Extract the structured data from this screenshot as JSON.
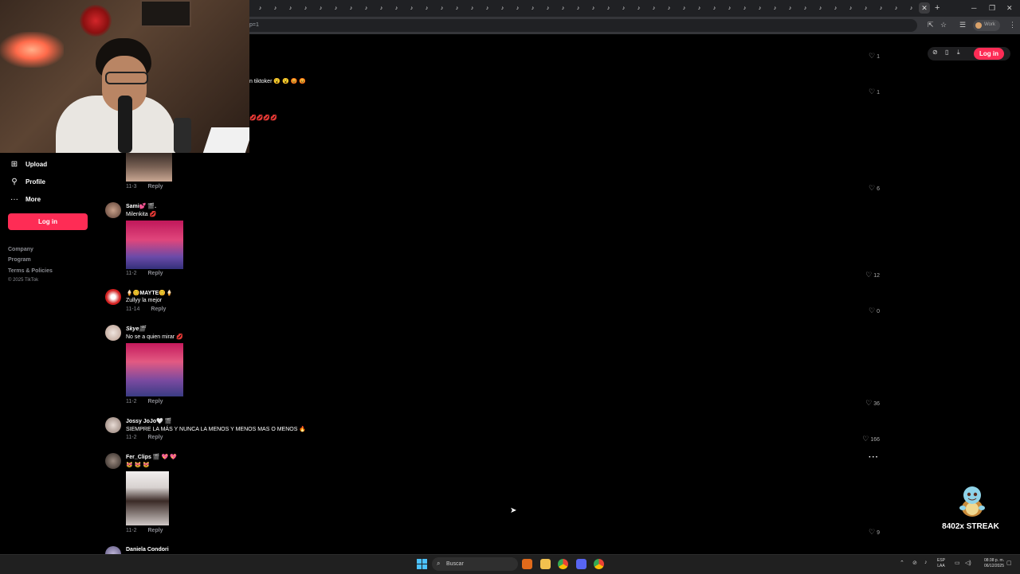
{
  "browser": {
    "tab_icon": "tiktok-icon",
    "tab_count": 44,
    "url_fragment": "p=1",
    "profile_label": "Work"
  },
  "sidebar": {
    "items": [
      {
        "label": "Upload",
        "icon": "plus-square-icon"
      },
      {
        "label": "Profile",
        "icon": "person-icon"
      },
      {
        "label": "More",
        "icon": "dots-icon"
      }
    ],
    "login_label": "Log in",
    "footer": [
      "Company",
      "Program",
      "Terms & Policies"
    ],
    "copyright": "© 2025 TikTok"
  },
  "header": {
    "login_label": "Log in"
  },
  "partial_lines": [
    {
      "text": "n tiktoker 😮 😮 😡 😡"
    },
    {
      "text": "💋💋💋💋"
    }
  ],
  "comments": [
    {
      "user": "",
      "text": "",
      "date": "11-3",
      "reply": "Reply",
      "likes": "1"
    },
    {
      "user": "",
      "text": "",
      "date": "",
      "reply": "",
      "likes": "1"
    },
    {
      "user": "",
      "text": "",
      "date": "11-3",
      "reply": "Reply",
      "likes": "6"
    },
    {
      "user": "Sami💕 🎬.",
      "text": "Milenkita 💋",
      "date": "11-2",
      "reply": "Reply",
      "likes": "12"
    },
    {
      "user": "🍦😊MAYTE😊🍦",
      "text": "Zullyy la mejor",
      "date": "11-14",
      "reply": "Reply",
      "likes": "0"
    },
    {
      "user": "Skye🎬",
      "text": "No se a quien mirar 💋",
      "date": "11-2",
      "reply": "Reply",
      "likes": "36"
    },
    {
      "user": "Jossy JoJo🤍 🎬",
      "text": "SIEMPRE LA MÁS Y NUNCA LA MENOS Y MENOS MAS O MENOS 🔥",
      "date": "11-2",
      "reply": "Reply",
      "likes": "166"
    },
    {
      "user": "Fer_Clips 🎬 💖 💖",
      "text": "😻 😻 😻",
      "date": "11-2",
      "reply": "Reply",
      "likes": "9"
    },
    {
      "user": "Daniela Condori",
      "text": "",
      "date": "",
      "reply": "",
      "likes": ""
    }
  ],
  "overlay": {
    "streak": "8402x STREAK"
  },
  "taskbar": {
    "search_placeholder": "Buscar",
    "lang_top": "ESP",
    "lang_bottom": "LAA",
    "time": "08:38 p. m.",
    "date": "06/12/2025"
  },
  "colors": {
    "accent": "#fe2c55",
    "background": "#000000",
    "muted": "#8a8b91"
  }
}
